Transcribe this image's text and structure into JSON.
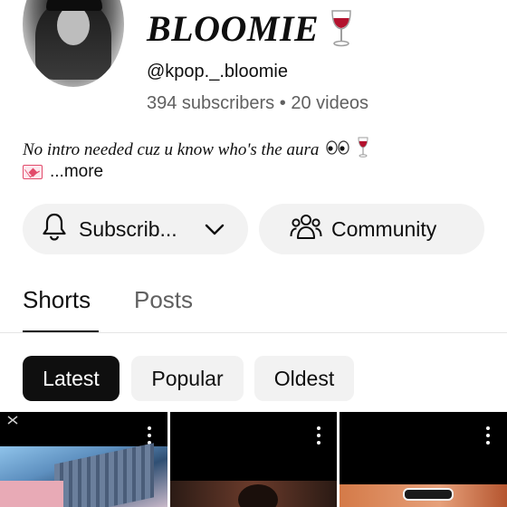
{
  "channel": {
    "name": "BLOOMIE",
    "handle": "@kpop._.bloomie",
    "subscribers": "394 subscribers",
    "separator": "•",
    "videos": "20 videos",
    "description": "No intro needed cuz u know who's the aura",
    "more_label": "...more",
    "icons": [
      "wine-glass-icon",
      "eyes-icon",
      "love-letter-icon"
    ]
  },
  "actions": {
    "subscribe_label": "Subscrib...",
    "community_label": "Community"
  },
  "tabs": [
    {
      "label": "Shorts",
      "active": true
    },
    {
      "label": "Posts",
      "active": false
    }
  ],
  "filters": [
    {
      "label": "Latest",
      "selected": true
    },
    {
      "label": "Popular",
      "selected": false
    },
    {
      "label": "Oldest",
      "selected": false
    }
  ],
  "colors": {
    "text": "#0f0f0f",
    "secondary_text": "#606060",
    "chip_bg": "#f2f2f2",
    "selected_chip_bg": "#0f0f0f",
    "wine": "#b3122e"
  }
}
